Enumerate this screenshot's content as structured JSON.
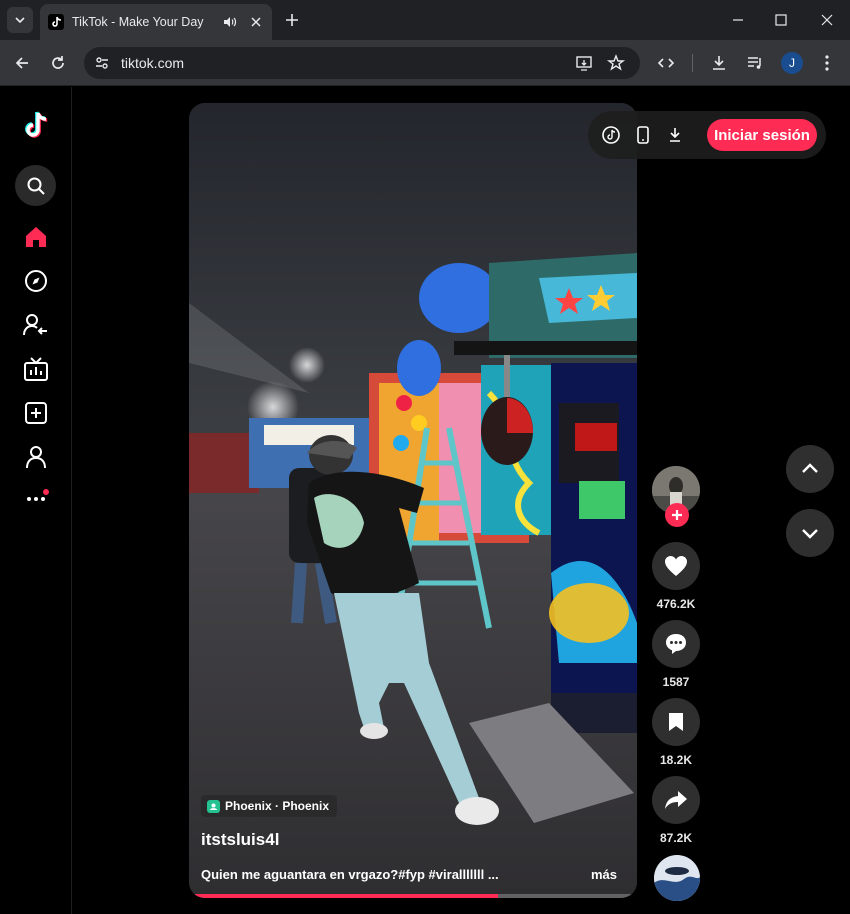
{
  "browser": {
    "tab_title": "TikTok - Make Your Day",
    "url": "tiktok.com",
    "profile_initial": "J"
  },
  "colors": {
    "brand": "#fe2c55",
    "background": "#000000",
    "chrome_dark": "#202124",
    "chrome_mid": "#35363a"
  },
  "sidebar": {
    "items": [
      {
        "name": "search",
        "icon": "search-icon"
      },
      {
        "name": "home",
        "icon": "home-icon",
        "active": true
      },
      {
        "name": "explore",
        "icon": "compass-icon"
      },
      {
        "name": "following",
        "icon": "following-icon"
      },
      {
        "name": "live",
        "icon": "live-tv-icon"
      },
      {
        "name": "upload",
        "icon": "plus-square-icon"
      },
      {
        "name": "profile",
        "icon": "profile-icon"
      },
      {
        "name": "more",
        "icon": "more-icon",
        "badge": true
      }
    ]
  },
  "header": {
    "login_label": "Iniciar sesión"
  },
  "video": {
    "location": "Phoenix · Phoenix",
    "username": "itstsluis4l",
    "caption": "Quien me aguantara en vrgazo?#fyp #viralllllll ...",
    "more_label": "más",
    "progress": 0.69
  },
  "actions": {
    "likes": "476.2K",
    "comments": "1587",
    "saves": "18.2K",
    "shares": "87.2K"
  }
}
